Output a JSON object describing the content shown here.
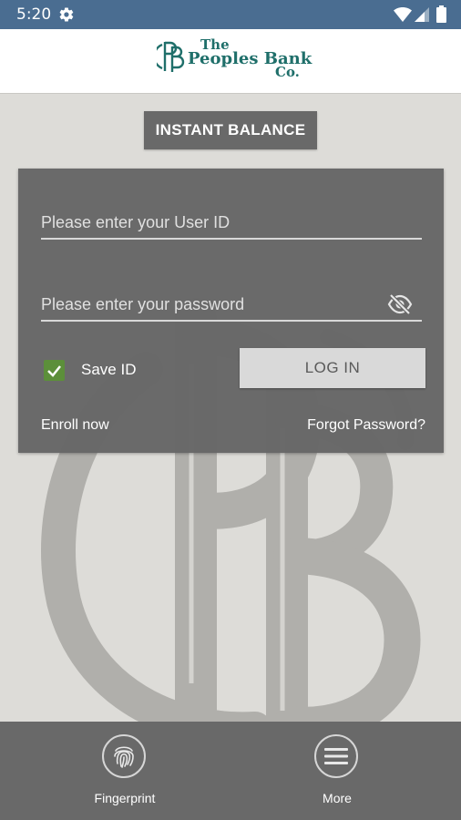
{
  "status_bar": {
    "time": "5:20",
    "icons": [
      "settings-gear-icon",
      "wifi-icon",
      "cell-signal-icon",
      "battery-icon"
    ],
    "background": "#4a6d91"
  },
  "header": {
    "logo": {
      "line1": "The",
      "line2": "Peoples Bank",
      "line3": "Co.",
      "mark_text": "PB",
      "color": "#1f6f6a"
    }
  },
  "instant_balance_label": "INSTANT BALANCE",
  "login": {
    "user_id_placeholder": "Please enter your User ID",
    "user_id_value": "",
    "password_placeholder": "Please enter your password",
    "password_value": "",
    "password_toggle_icon": "eye-off-icon",
    "save_id_label": "Save ID",
    "save_id_checked": true,
    "login_button_label": "LOG IN",
    "enroll_label": "Enroll now",
    "forgot_label": "Forgot Password?"
  },
  "bottom_nav": {
    "items": [
      {
        "label": "Fingerprint",
        "icon": "fingerprint-icon"
      },
      {
        "label": "More",
        "icon": "hamburger-menu-icon"
      }
    ]
  },
  "colors": {
    "page_background": "#dddcd8",
    "card_background": "#666666",
    "button_dark": "#696969",
    "checkbox_green": "#5c8f3a"
  }
}
